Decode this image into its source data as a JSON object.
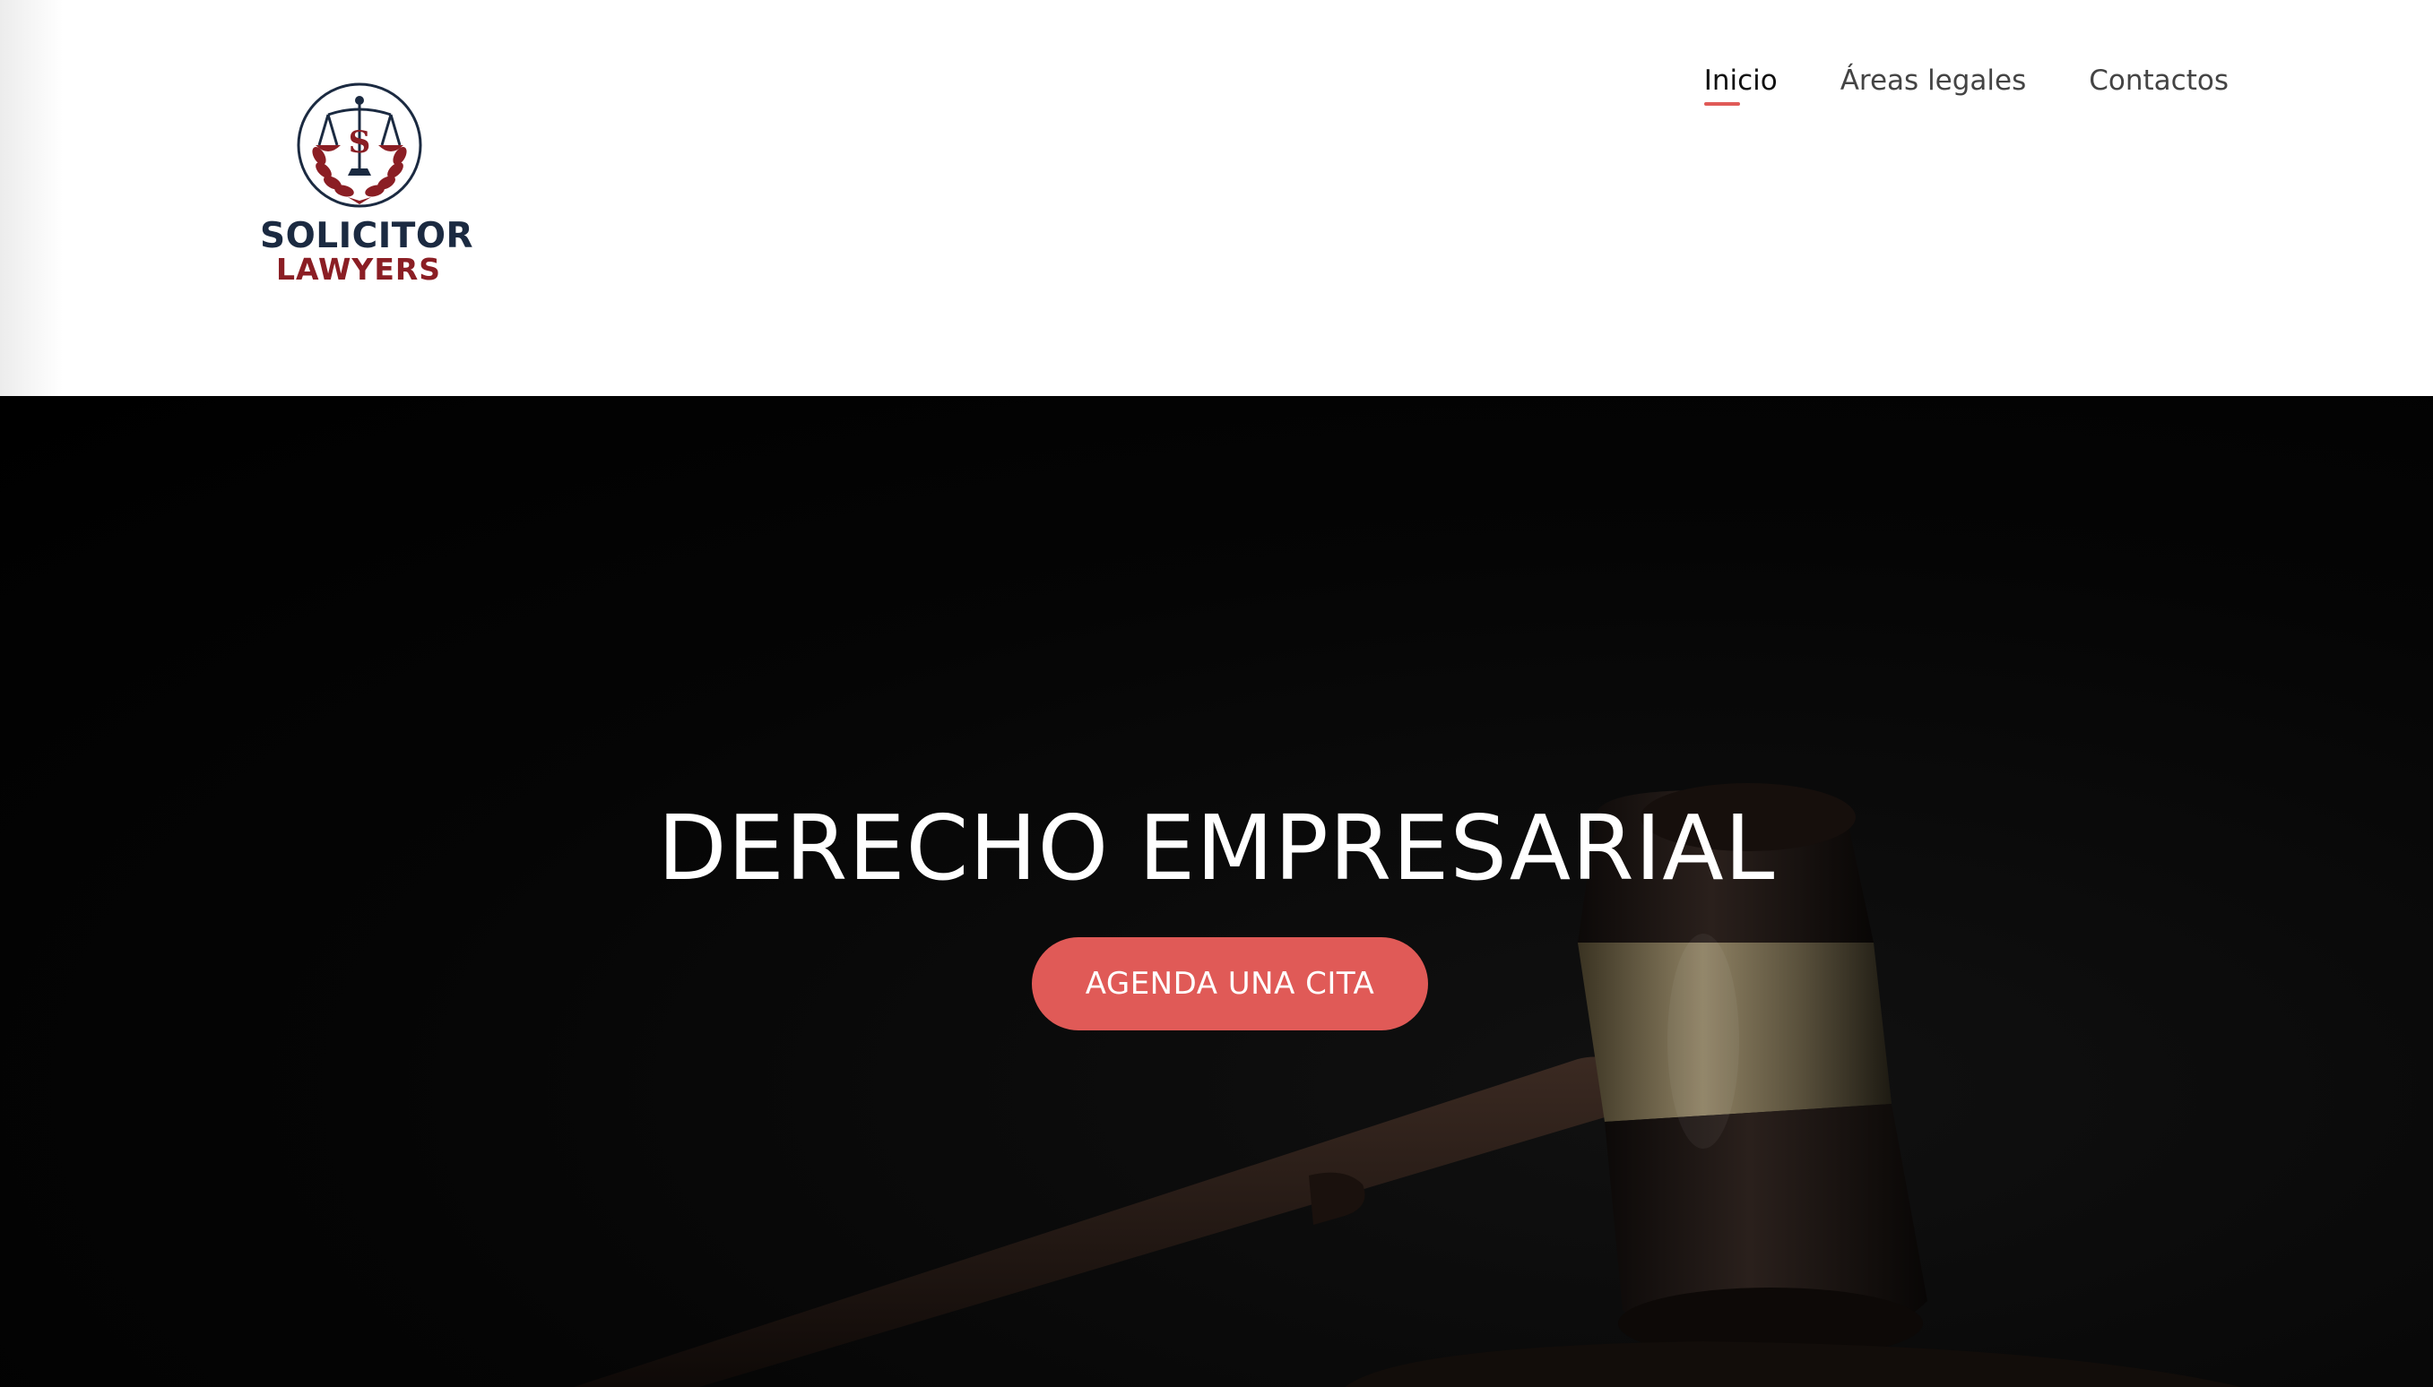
{
  "logo": {
    "line1": "SOLICITOR",
    "line2": "LAWYERS",
    "colors": {
      "navy": "#1b2a41",
      "red": "#8b1e24"
    }
  },
  "nav": {
    "items": [
      {
        "label": "Inicio",
        "active": true
      },
      {
        "label": "Áreas legales",
        "active": false
      },
      {
        "label": "Contactos",
        "active": false
      }
    ],
    "accent": "#e05a57"
  },
  "hero": {
    "title": "DERECHO EMPRESARIAL",
    "cta_label": "AGENDA UNA CITA",
    "background_image": "gavel-on-dark-background"
  }
}
